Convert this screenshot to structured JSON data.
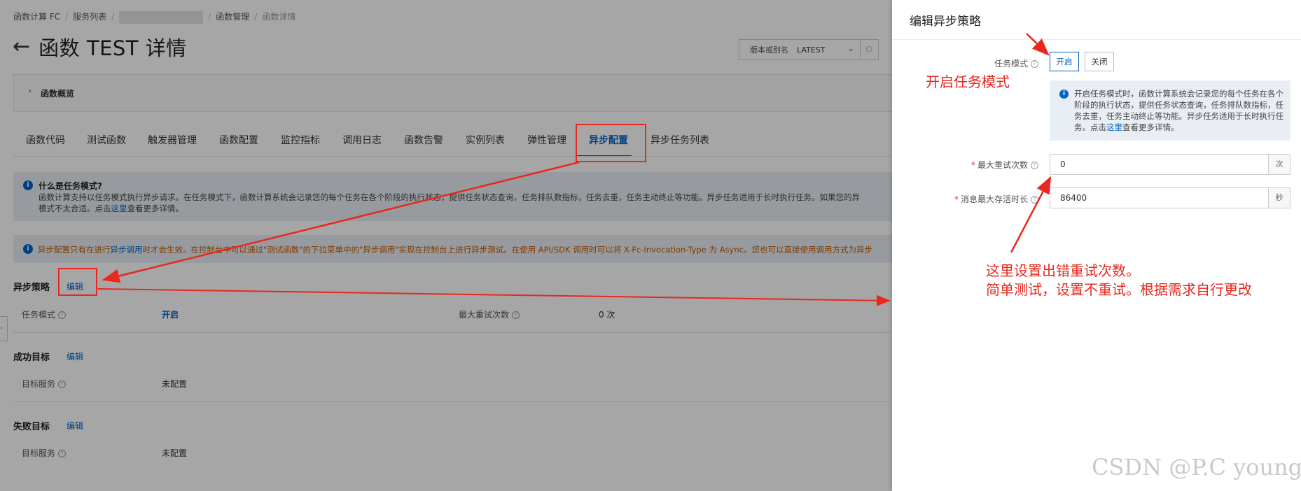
{
  "breadcrumb": {
    "items": [
      "函数计算 FC",
      "服务列表",
      "函数管理",
      "函数详情"
    ]
  },
  "page": {
    "title": "函数 TEST 详情"
  },
  "version_select": {
    "label": "版本或别名",
    "value": "LATEST"
  },
  "overview": {
    "label": "函数概览"
  },
  "tabs": [
    {
      "label": "函数代码"
    },
    {
      "label": "测试函数"
    },
    {
      "label": "触发器管理"
    },
    {
      "label": "函数配置"
    },
    {
      "label": "监控指标"
    },
    {
      "label": "调用日志"
    },
    {
      "label": "函数告警"
    },
    {
      "label": "实例列表"
    },
    {
      "label": "弹性管理"
    },
    {
      "label": "异步配置"
    },
    {
      "label": "异步任务列表"
    }
  ],
  "info_task": {
    "title": "什么是任务模式?",
    "text_line1": "函数计算支持以任务模式执行异步请求。在任务模式下，函数计算系统会记录您的每个任务在各个阶段的执行状态，提供任务状态查询，任务排队数指标，任务去重，任务主动终止等功能。异步任务适用于长时执行任务。如果您的异",
    "text_line2a": "模式不太合适。点击",
    "link": "这里",
    "text_line2b": "查看更多详情。"
  },
  "info_async": {
    "pre": "异步配置只有在进行",
    "link": "异步调用",
    "post": "时才会生效。在控制台中可以通过\"测试函数\"的下拉菜单中的\"异步调用\"实现在控制台上进行异步测试。在使用 API/SDK 调用时可以将 X-Fc-Invocation-Type 为 Async。您也可以直接使用调用方式为异步"
  },
  "async_policy": {
    "title": "异步策略",
    "edit": "编辑",
    "task_mode_label": "任务模式",
    "task_mode_value": "开启",
    "max_retry_label": "最大重试次数",
    "max_retry_value": "0 次"
  },
  "success_target": {
    "title": "成功目标",
    "edit": "编辑",
    "service_label": "目标服务",
    "service_value": "未配置"
  },
  "failure_target": {
    "title": "失败目标",
    "edit": "编辑",
    "service_label": "目标服务",
    "service_value": "未配置"
  },
  "drawer": {
    "title": "编辑异步策略",
    "task_mode_label": "任务模式",
    "on_label": "开启",
    "off_label": "关闭",
    "note_pre": "开启任务模式时，函数计算系统会记录您的每个任务在各个阶段的执行状态，提供任务状态查询，任务排队数指标，任务去重，任务主动终止等功能。异步任务适用于长时执行任务。点击",
    "note_link": "这里",
    "note_post": "查看更多详情。",
    "retry_label": "最大重试次数",
    "retry_value": "0",
    "retry_unit": "次",
    "ttl_label": "消息最大存活时长",
    "ttl_value": "86400",
    "ttl_unit": "秒"
  },
  "annotations": {
    "enable_task_mode": "开启任务模式",
    "retry_note_line1": "这里设置出错重试次数。",
    "retry_note_line2": "简单测试，设置不重试。根据需求自行更改"
  },
  "watermark": "CSDN @P.C young",
  "colors": {
    "accent": "#0064c8",
    "annotation": "#e8281e",
    "warning_text": "#c25a00"
  }
}
